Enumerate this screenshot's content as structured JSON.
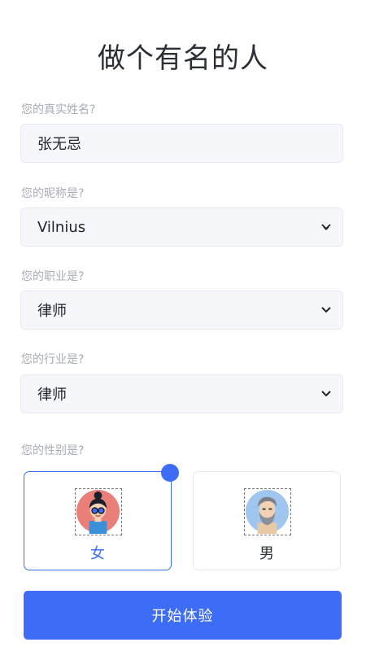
{
  "title": "做个有名的人",
  "fields": [
    {
      "label": "您的真实姓名?",
      "value": "张无忌",
      "type": "text"
    },
    {
      "label": "您的昵称是?",
      "value": "Vilnius",
      "type": "select"
    },
    {
      "label": "您的职业是?",
      "value": "律师",
      "type": "select"
    },
    {
      "label": "您的行业是?",
      "value": "律师",
      "type": "select"
    }
  ],
  "gender": {
    "label": "您的性别是?",
    "options": [
      {
        "label": "女",
        "selected": true,
        "avatar": "female-avatar-icon"
      },
      {
        "label": "男",
        "selected": false,
        "avatar": "male-avatar-icon"
      }
    ]
  },
  "start_button": "开始体验",
  "colors": {
    "accent": "#3d6cf6",
    "label": "#a7acb6",
    "field_bg": "#f6f7fb"
  }
}
